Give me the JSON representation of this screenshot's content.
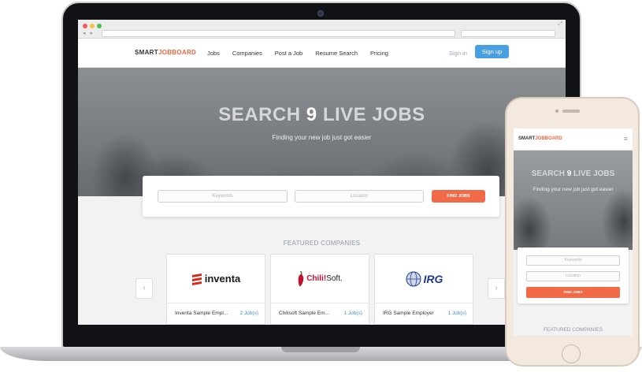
{
  "browser": {
    "nav_arrows": "◂ ▸",
    "url_placeholder": "",
    "search_placeholder": "",
    "expand_icon": "⤢"
  },
  "site": {
    "logo_part1": "SMART",
    "logo_part2": "JOBBOARD",
    "nav": [
      "Jobs",
      "Companies",
      "Post a Job",
      "Resume Search",
      "Pricing"
    ],
    "sign_in": "Sign in",
    "sign_up": "Sign up"
  },
  "hero": {
    "title_prefix": "SEARCH ",
    "title_number": "9",
    "title_suffix": " LIVE JOBS",
    "subtitle": "Finding your new job just got easier"
  },
  "search": {
    "keywords_placeholder": "Keywords",
    "location_placeholder": "Location",
    "find_button": "FIND JOBS"
  },
  "featured": {
    "title": "FEATURED COMPANIES",
    "prev_arrow": "‹",
    "next_arrow": "›",
    "companies": [
      {
        "logo_text": "inventa",
        "name": "Inventa Sample Empl...",
        "jobs": "2 Job(s)"
      },
      {
        "logo_text_a": "Chili!",
        "logo_text_b": "Soft.",
        "name": "Chilisoft Sample Em...",
        "jobs": "1 Job(s)"
      },
      {
        "logo_text": "IRG",
        "name": "IRG Sample Employer",
        "jobs": "1 Job(s)"
      }
    ]
  },
  "mobile": {
    "menu_icon": "≡"
  },
  "colors": {
    "accent_orange": "#f06a47",
    "signup_blue": "#4a9fe0",
    "link_blue": "#3b8fd5"
  }
}
